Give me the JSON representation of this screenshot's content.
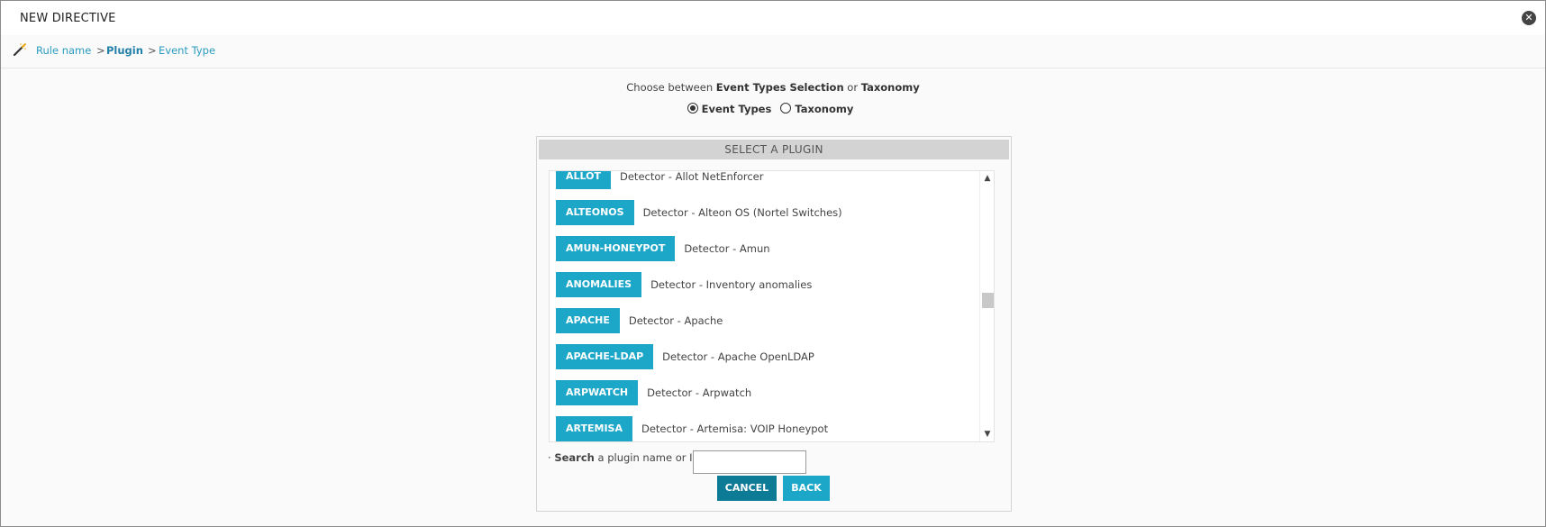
{
  "window": {
    "title": "NEW DIRECTIVE",
    "close_glyph": "✕"
  },
  "breadcrumb": {
    "items": [
      {
        "label": "Rule name",
        "active": false
      },
      {
        "label": "Plugin",
        "active": true
      },
      {
        "label": "Event Type",
        "active": false
      }
    ],
    "separator": ">"
  },
  "selection": {
    "prompt_pre": "Choose between ",
    "prompt_opt1": "Event Types Selection",
    "prompt_mid": " or ",
    "prompt_opt2": "Taxonomy",
    "options": [
      {
        "label": "Event Types",
        "checked": true
      },
      {
        "label": "Taxonomy",
        "checked": false
      }
    ]
  },
  "plugin_panel": {
    "header": "SELECT A PLUGIN",
    "plugins": [
      {
        "name": "ALLOT",
        "description": "Detector - Allot NetEnforcer"
      },
      {
        "name": "ALTEONOS",
        "description": "Detector - Alteon OS (Nortel Switches)"
      },
      {
        "name": "AMUN-HONEYPOT",
        "description": "Detector - Amun"
      },
      {
        "name": "ANOMALIES",
        "description": "Detector - Inventory anomalies"
      },
      {
        "name": "APACHE",
        "description": "Detector - Apache"
      },
      {
        "name": "APACHE-LDAP",
        "description": "Detector - Apache OpenLDAP"
      },
      {
        "name": "ARPWATCH",
        "description": "Detector - Arpwatch"
      },
      {
        "name": "ARTEMISA",
        "description": "Detector - Artemisa: VOIP Honeypot"
      }
    ],
    "scroll_up_glyph": "▲",
    "scroll_down_glyph": "▼"
  },
  "search": {
    "prefix": "· ",
    "bold_label": "Search",
    "label_rest": " a plugin name or ID:",
    "value": ""
  },
  "actions": {
    "cancel_label": "CANCEL",
    "back_label": "BACK"
  },
  "colors": {
    "accent": "#1ca7c8",
    "accent_dark": "#0e7b96",
    "link": "#2a9bbf"
  }
}
